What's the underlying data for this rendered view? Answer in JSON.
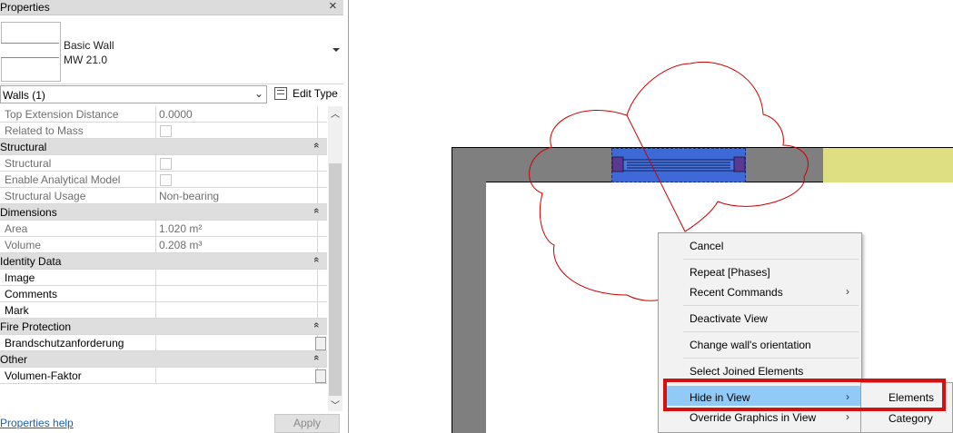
{
  "properties": {
    "title": "Properties",
    "close_icon": "close-icon",
    "type_family": "Basic Wall",
    "type_name": "MW 21.0",
    "filter": "Walls (1)",
    "edit_type": "Edit Type",
    "rows": [
      {
        "kind": "prop",
        "name": "Top Extension Distance",
        "value": "0.0000",
        "dim": true
      },
      {
        "kind": "prop",
        "name": "Related to Mass",
        "value": "",
        "dim": true,
        "checkbox": true
      },
      {
        "kind": "group",
        "name": "Structural"
      },
      {
        "kind": "prop",
        "name": "Structural",
        "value": "",
        "dim": true,
        "checkbox": true
      },
      {
        "kind": "prop",
        "name": "Enable Analytical Model",
        "value": "",
        "dim": true,
        "checkbox": true
      },
      {
        "kind": "prop",
        "name": "Structural Usage",
        "value": "Non-bearing",
        "dim": true
      },
      {
        "kind": "group",
        "name": "Dimensions"
      },
      {
        "kind": "prop",
        "name": "Area",
        "value": "1.020 m²",
        "dim": true
      },
      {
        "kind": "prop",
        "name": "Volume",
        "value": "0.208 m³",
        "dim": true
      },
      {
        "kind": "group",
        "name": "Identity Data"
      },
      {
        "kind": "prop",
        "name": "Image",
        "value": ""
      },
      {
        "kind": "prop",
        "name": "Comments",
        "value": ""
      },
      {
        "kind": "prop",
        "name": "Mark",
        "value": ""
      },
      {
        "kind": "group",
        "name": "Fire Protection"
      },
      {
        "kind": "prop",
        "name": "Brandschutzanforderung",
        "value": "",
        "button": true
      },
      {
        "kind": "group",
        "name": "Other"
      },
      {
        "kind": "prop",
        "name": "Volumen-Faktor",
        "value": "",
        "button": true
      }
    ],
    "help_link": "Properties help",
    "apply": "Apply"
  },
  "context_menu": {
    "cancel": "Cancel",
    "repeat": "Repeat [Phases]",
    "recent": "Recent Commands",
    "deactivate": "Deactivate View",
    "change_orientation": "Change wall's orientation",
    "select_joined": "Select Joined Elements",
    "hide_in_view": "Hide in View",
    "override_graphics": "Override Graphics in View",
    "submenu": {
      "elements": "Elements",
      "category": "Category"
    }
  },
  "colors": {
    "wall": "#7f7f7f",
    "selected_window": "#3d6ad6",
    "revision_cloud": "#cc0000",
    "highlight": "#91c9f7",
    "callout_box": "#d41010"
  }
}
